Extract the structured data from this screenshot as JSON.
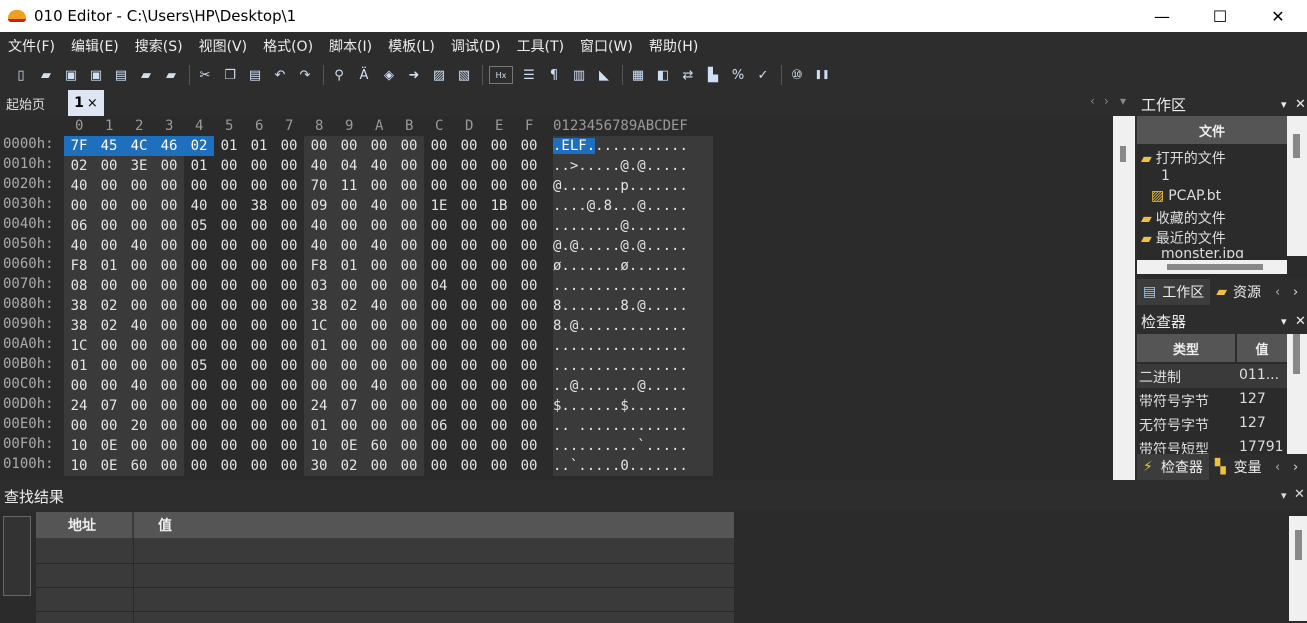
{
  "window": {
    "title": "010 Editor - C:\\Users\\HP\\Desktop\\1",
    "minimize": "—",
    "maximize": "☐",
    "close": "✕"
  },
  "menu": [
    "文件(F)",
    "编辑(E)",
    "搜索(S)",
    "视图(V)",
    "格式(O)",
    "脚本(I)",
    "模板(L)",
    "调试(D)",
    "工具(T)",
    "窗口(W)",
    "帮助(H)"
  ],
  "toolbar_icons": [
    "new-file-icon",
    "open-folder-icon",
    "save-icon",
    "save-as-icon",
    "save-all-icon",
    "open-icon",
    "open-workspace-icon",
    "cut-icon",
    "copy-icon",
    "paste-icon",
    "undo-icon",
    "redo-icon",
    "find-icon",
    "replace-icon",
    "find-in-files-icon",
    "goto-icon",
    "templates-icon",
    "scripts-icon",
    "hex-icon",
    "columns-icon",
    "pilcrow-icon",
    "table-icon",
    "highlight-icon",
    "calculator-icon",
    "inspector-icon",
    "compare-icon",
    "histogram-icon",
    "percent-icon",
    "checksum-icon",
    "base-convert-icon",
    "pause-icon"
  ],
  "tabs": {
    "start": "起始页",
    "file": "1",
    "close": "×"
  },
  "hex": {
    "column_headers": [
      "0",
      "1",
      "2",
      "3",
      "4",
      "5",
      "6",
      "7",
      "8",
      "9",
      "A",
      "B",
      "C",
      "D",
      "E",
      "F"
    ],
    "ascii_header": "0123456789ABCDEF",
    "rows": [
      {
        "addr": "0000h:",
        "bytes": [
          "7F",
          "45",
          "4C",
          "46",
          "02",
          "01",
          "01",
          "00",
          "00",
          "00",
          "00",
          "00",
          "00",
          "00",
          "00",
          "00"
        ],
        "ascii_sel": ".ELF.",
        "ascii": "..........."
      },
      {
        "addr": "0010h:",
        "bytes": [
          "02",
          "00",
          "3E",
          "00",
          "01",
          "00",
          "00",
          "00",
          "40",
          "04",
          "40",
          "00",
          "00",
          "00",
          "00",
          "00"
        ],
        "ascii_sel": "",
        "ascii": "..>.....@.@....."
      },
      {
        "addr": "0020h:",
        "bytes": [
          "40",
          "00",
          "00",
          "00",
          "00",
          "00",
          "00",
          "00",
          "70",
          "11",
          "00",
          "00",
          "00",
          "00",
          "00",
          "00"
        ],
        "ascii_sel": "",
        "ascii": "@.......p......."
      },
      {
        "addr": "0030h:",
        "bytes": [
          "00",
          "00",
          "00",
          "00",
          "40",
          "00",
          "38",
          "00",
          "09",
          "00",
          "40",
          "00",
          "1E",
          "00",
          "1B",
          "00"
        ],
        "ascii_sel": "",
        "ascii": "....@.8...@....."
      },
      {
        "addr": "0040h:",
        "bytes": [
          "06",
          "00",
          "00",
          "00",
          "05",
          "00",
          "00",
          "00",
          "40",
          "00",
          "00",
          "00",
          "00",
          "00",
          "00",
          "00"
        ],
        "ascii_sel": "",
        "ascii": "........@......."
      },
      {
        "addr": "0050h:",
        "bytes": [
          "40",
          "00",
          "40",
          "00",
          "00",
          "00",
          "00",
          "00",
          "40",
          "00",
          "40",
          "00",
          "00",
          "00",
          "00",
          "00"
        ],
        "ascii_sel": "",
        "ascii": "@.@.....@.@....."
      },
      {
        "addr": "0060h:",
        "bytes": [
          "F8",
          "01",
          "00",
          "00",
          "00",
          "00",
          "00",
          "00",
          "F8",
          "01",
          "00",
          "00",
          "00",
          "00",
          "00",
          "00"
        ],
        "ascii_sel": "",
        "ascii": "ø.......ø......."
      },
      {
        "addr": "0070h:",
        "bytes": [
          "08",
          "00",
          "00",
          "00",
          "00",
          "00",
          "00",
          "00",
          "03",
          "00",
          "00",
          "00",
          "04",
          "00",
          "00",
          "00"
        ],
        "ascii_sel": "",
        "ascii": "................"
      },
      {
        "addr": "0080h:",
        "bytes": [
          "38",
          "02",
          "00",
          "00",
          "00",
          "00",
          "00",
          "00",
          "38",
          "02",
          "40",
          "00",
          "00",
          "00",
          "00",
          "00"
        ],
        "ascii_sel": "",
        "ascii": "8.......8.@....."
      },
      {
        "addr": "0090h:",
        "bytes": [
          "38",
          "02",
          "40",
          "00",
          "00",
          "00",
          "00",
          "00",
          "1C",
          "00",
          "00",
          "00",
          "00",
          "00",
          "00",
          "00"
        ],
        "ascii_sel": "",
        "ascii": "8.@............."
      },
      {
        "addr": "00A0h:",
        "bytes": [
          "1C",
          "00",
          "00",
          "00",
          "00",
          "00",
          "00",
          "00",
          "01",
          "00",
          "00",
          "00",
          "00",
          "00",
          "00",
          "00"
        ],
        "ascii_sel": "",
        "ascii": "................"
      },
      {
        "addr": "00B0h:",
        "bytes": [
          "01",
          "00",
          "00",
          "00",
          "05",
          "00",
          "00",
          "00",
          "00",
          "00",
          "00",
          "00",
          "00",
          "00",
          "00",
          "00"
        ],
        "ascii_sel": "",
        "ascii": "................"
      },
      {
        "addr": "00C0h:",
        "bytes": [
          "00",
          "00",
          "40",
          "00",
          "00",
          "00",
          "00",
          "00",
          "00",
          "00",
          "40",
          "00",
          "00",
          "00",
          "00",
          "00"
        ],
        "ascii_sel": "",
        "ascii": "..@.......@....."
      },
      {
        "addr": "00D0h:",
        "bytes": [
          "24",
          "07",
          "00",
          "00",
          "00",
          "00",
          "00",
          "00",
          "24",
          "07",
          "00",
          "00",
          "00",
          "00",
          "00",
          "00"
        ],
        "ascii_sel": "",
        "ascii": "$.......$......."
      },
      {
        "addr": "00E0h:",
        "bytes": [
          "00",
          "00",
          "20",
          "00",
          "00",
          "00",
          "00",
          "00",
          "01",
          "00",
          "00",
          "00",
          "06",
          "00",
          "00",
          "00"
        ],
        "ascii_sel": "",
        "ascii": ".. ............."
      },
      {
        "addr": "00F0h:",
        "bytes": [
          "10",
          "0E",
          "00",
          "00",
          "00",
          "00",
          "00",
          "00",
          "10",
          "0E",
          "60",
          "00",
          "00",
          "00",
          "00",
          "00"
        ],
        "ascii_sel": "",
        "ascii": "..........`....."
      },
      {
        "addr": "0100h:",
        "bytes": [
          "10",
          "0E",
          "60",
          "00",
          "00",
          "00",
          "00",
          "00",
          "30",
          "02",
          "00",
          "00",
          "00",
          "00",
          "00",
          "00"
        ],
        "ascii_sel": "",
        "ascii": "..`.....0......."
      }
    ]
  },
  "workspace": {
    "title": "工作区",
    "column": "文件",
    "items": [
      {
        "label": "打开的文件",
        "icon": "folder-open-icon",
        "indent": 0
      },
      {
        "label": "1",
        "icon": "",
        "indent": 2
      },
      {
        "label": "PCAP.bt",
        "icon": "template-file-icon",
        "indent": 1
      },
      {
        "label": "收藏的文件",
        "icon": "favorites-folder-icon",
        "indent": 0
      },
      {
        "label": "最近的文件",
        "icon": "recent-folder-icon",
        "indent": 0
      },
      {
        "label": "monster.jpg",
        "icon": "",
        "indent": 2
      }
    ],
    "tabs": [
      "工作区",
      "资源"
    ]
  },
  "inspector": {
    "title": "检查器",
    "col_type": "类型",
    "col_value": "值",
    "rows": [
      {
        "type": "二进制",
        "value": "011..."
      },
      {
        "type": "带符号字节",
        "value": "127"
      },
      {
        "type": "无符号字节",
        "value": "127"
      },
      {
        "type": "带符号短型",
        "value": "17791"
      }
    ],
    "tabs": [
      "检查器",
      "变量"
    ]
  },
  "find": {
    "title": "查找结果",
    "col_addr": "地址",
    "col_value": "值"
  },
  "colors": {
    "selection": "#1f6fbf",
    "background": "#2b2b2b",
    "panel": "#2d2d2d"
  }
}
